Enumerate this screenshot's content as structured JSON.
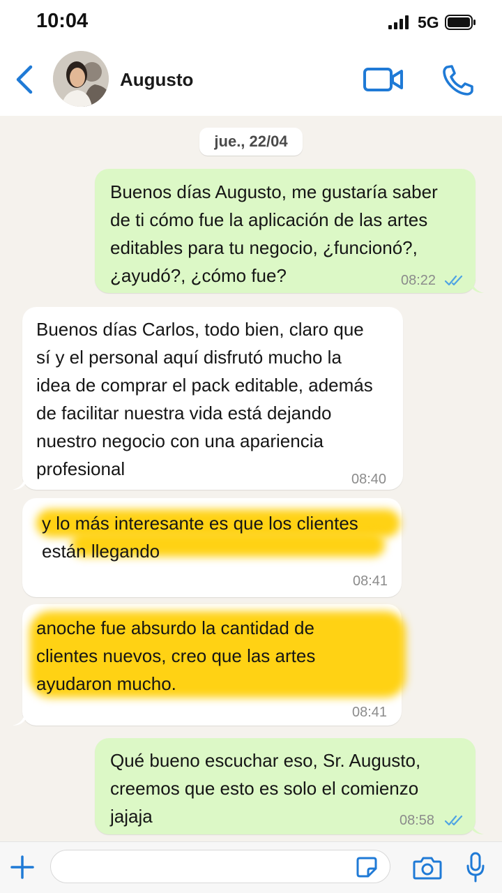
{
  "status_bar": {
    "time": "10:04",
    "network": "5G"
  },
  "header": {
    "contact_name": "Augusto",
    "icons": [
      "chevron-left-icon",
      "avatar",
      "video-camera-icon",
      "phone-icon"
    ]
  },
  "chat": {
    "date_chip": "jue., 22/04",
    "messages": [
      {
        "direction": "outgoing",
        "text": "Buenos días Augusto, me gustaría saber\nde ti cómo fue la aplicación de las artes\neditables para tu negocio, ¿funcionó?,\n¿ayudó?, ¿cómo fue?",
        "time": "08:22",
        "status": "read"
      },
      {
        "direction": "incoming",
        "text": "Buenos días Carlos, todo bien, claro que\nsí y el personal aquí disfrutó mucho la\nidea de comprar el pack editable, además\nde facilitar nuestra vida está dejando\nnuestro negocio con una apariencia\nprofesional",
        "time": "08:40"
      },
      {
        "direction": "incoming",
        "text": "y lo más interesante es que los clientes\nestán llegando",
        "time": "08:41",
        "highlighted": true
      },
      {
        "direction": "incoming",
        "text": "anoche fue absurdo la cantidad de\nclientes nuevos, creo que las artes\nayudaron mucho.",
        "time": "08:41",
        "highlighted": true
      },
      {
        "direction": "outgoing",
        "text": "Qué bueno escuchar eso, Sr. Augusto,\ncreemos que esto es solo el comienzo\njajaja",
        "time": "08:58",
        "status": "read"
      }
    ]
  },
  "input_bar": {
    "placeholder": "",
    "icons": [
      "plus-icon",
      "sticker-icon",
      "camera-icon",
      "microphone-icon"
    ]
  },
  "colors": {
    "accent": "#1f7ad6",
    "outgoing_bubble": "#dcf8c6",
    "incoming_bubble": "#ffffff",
    "chat_background": "#f5f2ed",
    "highlight": "#ffce00",
    "read_ticks": "#4fa3e3"
  }
}
